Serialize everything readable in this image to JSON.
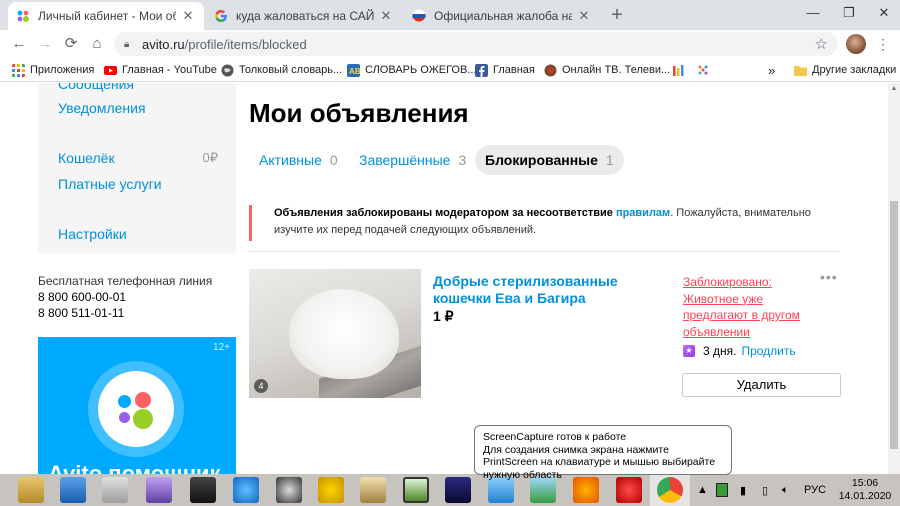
{
  "browser": {
    "tabs": [
      {
        "title": "Личный кабинет - Мои объявл",
        "active": true,
        "favicon": "avito-icon"
      },
      {
        "title": "куда жаловаться на САЙТ авит",
        "active": false,
        "favicon": "google-icon"
      },
      {
        "title": "Официальная жалоба на руков",
        "active": false,
        "favicon": "russia-flag-icon"
      }
    ],
    "url_host": "avito.ru",
    "url_path": "/profile/items/blocked",
    "bookmarks": [
      {
        "label": "Приложения",
        "icon": "apps-icon",
        "color": "#4285f4"
      },
      {
        "label": "Главная - YouTube",
        "icon": "youtube-icon",
        "color": "#ff0000"
      },
      {
        "label": "Толковый словарь...",
        "icon": "globe-icon",
        "color": "#555555"
      },
      {
        "label": "СЛОВАРЬ ОЖЕГОВ...",
        "icon": "dictionary-icon",
        "color": "#2a6db5"
      },
      {
        "label": "Главная",
        "icon": "facebook-icon",
        "color": "#3b5998"
      },
      {
        "label": "Онлайн ТВ. Телеви...",
        "icon": "tv-icon",
        "color": "#c0392b"
      }
    ],
    "more_bookmarks": "»",
    "other_bookmarks": "Другие закладки"
  },
  "sidebar": {
    "items": [
      {
        "label": "Сообщения"
      },
      {
        "label": "Уведомления"
      },
      {
        "label": "Кошелёк"
      },
      {
        "label": "Платные услуги"
      },
      {
        "label": "Настройки"
      }
    ],
    "wallet_amount": "0₽",
    "phone_label": "Бесплатная телефонная линия",
    "phones": [
      "8 800 600-00-01",
      "8 800 511-01-11"
    ],
    "promo_age": "12+",
    "promo_text": "Avito помощник"
  },
  "main": {
    "title": "Мои объявления",
    "tabs": [
      {
        "label": "Активные",
        "count": "0",
        "active": false
      },
      {
        "label": "Завершённые",
        "count": "3",
        "active": false
      },
      {
        "label": "Блокированные",
        "count": "1",
        "active": true
      }
    ],
    "notice_bold": "Объявления заблокированы модератором за несоответствие",
    "notice_link": "правилам",
    "notice_rest": ". Пожалуйста, внимательно изучите их перед подачей следующих объявлений.",
    "item": {
      "title": "Добрые стерилизованные кошечки Ева и Багира",
      "price": "1 ₽",
      "photo_count": "4",
      "status": "Заблокировано: Животное уже предлагают в другом объявлении",
      "promo_days": "3 дня.",
      "extend": "Продлить",
      "delete": "Удалить"
    }
  },
  "tooltip": {
    "title": "ScreenCapture готов к работе",
    "body": "Для создания снимка экрана нажмите PrintScreen на клавиатуре и мышью выбирайте нужную область"
  },
  "taskbar": {
    "lang": "РУС",
    "time": "15:06",
    "date": "14.01.2020"
  },
  "colors": {
    "accent": "#0091d9",
    "blocked": "#ff4053",
    "notice_border": "#ff6163"
  }
}
